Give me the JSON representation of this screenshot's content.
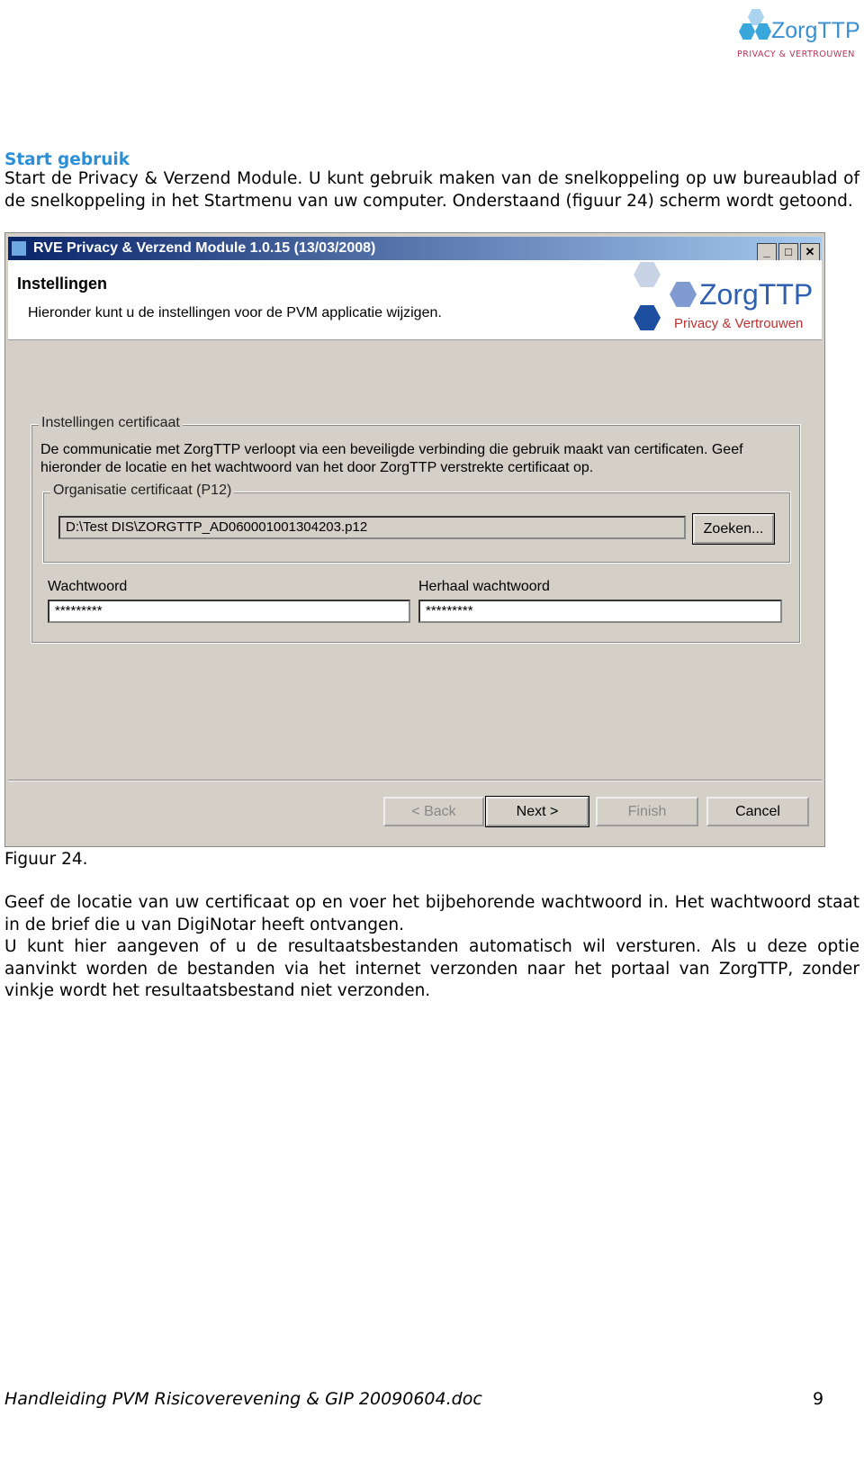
{
  "logo": {
    "name": "ZorgTTP",
    "tagline": "PRIVACY & VERTROUWEN"
  },
  "section_title": "Start gebruik",
  "intro": "Start de Privacy & Verzend Module. U kunt gebruik maken van de snelkoppeling op uw bureaublad of de snelkoppeling in het Startmenu van uw computer. Onderstaand (figuur 24) scherm wordt getoond.",
  "window": {
    "title": "RVE Privacy & Verzend Module 1.0.15 (13/03/2008)",
    "header_title": "Instellingen",
    "header_subtitle": "Hieronder kunt u de instellingen voor de PVM applicatie wijzigen.",
    "logo_name": "ZorgTTP",
    "logo_tagline": "Privacy & Vertrouwen",
    "group_label": "Instellingen certificaat",
    "group_text": "De communicatie met ZorgTTP verloopt via een beveiligde verbinding die gebruik maakt van certificaten. Geef hieronder de locatie en het wachtwoord van het door ZorgTTP verstrekte certificaat op.",
    "org_label": "Organisatie certificaat (P12)",
    "cert_path": "D:\\Test DIS\\ZORGTTP_AD060001001304203.p12",
    "browse": "Zoeken...",
    "password_label": "Wachtwoord",
    "password_value": "*********",
    "repeat_label": "Herhaal wachtwoord",
    "repeat_value": "*********",
    "back": "< Back",
    "next": "Next >",
    "finish": "Finish",
    "cancel": "Cancel"
  },
  "caption": "Figuur 24.",
  "para1": "Geef de locatie van uw certificaat op en voer het bijbehorende wachtwoord in. Het wachtwoord staat in de brief die u van DigiNotar heeft ontvangen.",
  "para2": "U kunt hier aangeven of u de resultaatsbestanden automatisch wil versturen. Als u deze optie aanvinkt worden de bestanden via het internet verzonden naar het portaal van ZorgTTP, zonder vinkje wordt het resultaatsbestand niet verzonden.",
  "footer": "Handleiding PVM Risicoverevening & GIP 20090604.doc",
  "page_number": "9"
}
